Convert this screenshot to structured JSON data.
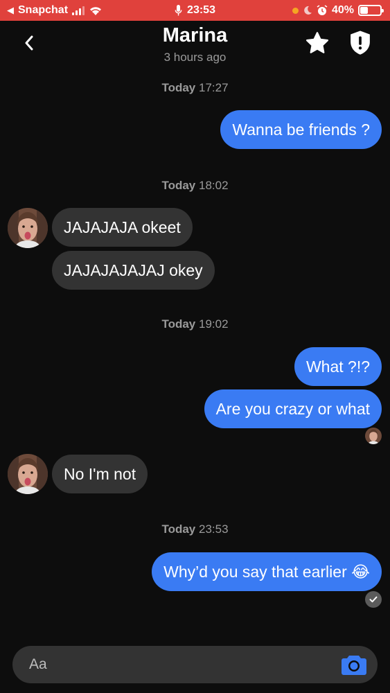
{
  "status_bar": {
    "back_app": "Snapchat",
    "time": "23:53",
    "battery": "40%",
    "battery_level": 0.4
  },
  "header": {
    "title": "Marina",
    "subtitle": "3 hours ago",
    "icons": [
      "back-chevron-icon",
      "star-icon",
      "shield-icon"
    ]
  },
  "messages": {
    "ts1": {
      "day": "Today",
      "time": "17:27"
    },
    "m1": "Wanna be friends ?",
    "ts2": {
      "day": "Today",
      "time": "18:02"
    },
    "m2": "JAJAJAJA okeet",
    "m3": "JAJAJAJAJAJ okey",
    "ts3": {
      "day": "Today",
      "time": "19:02"
    },
    "m4": "What ?!?",
    "m5": "Are you crazy or what",
    "m6": "No I'm not",
    "ts4": {
      "day": "Today",
      "time": "23:53"
    },
    "m7": "Why’d you say that earlier 😂"
  },
  "composer": {
    "placeholder": "Aa",
    "camera_icon": "camera-icon"
  },
  "colors": {
    "accent": "#3a7bf3",
    "status_bar": "#e0413c",
    "incoming_bubble": "#333333",
    "background": "#0d0d0d"
  }
}
